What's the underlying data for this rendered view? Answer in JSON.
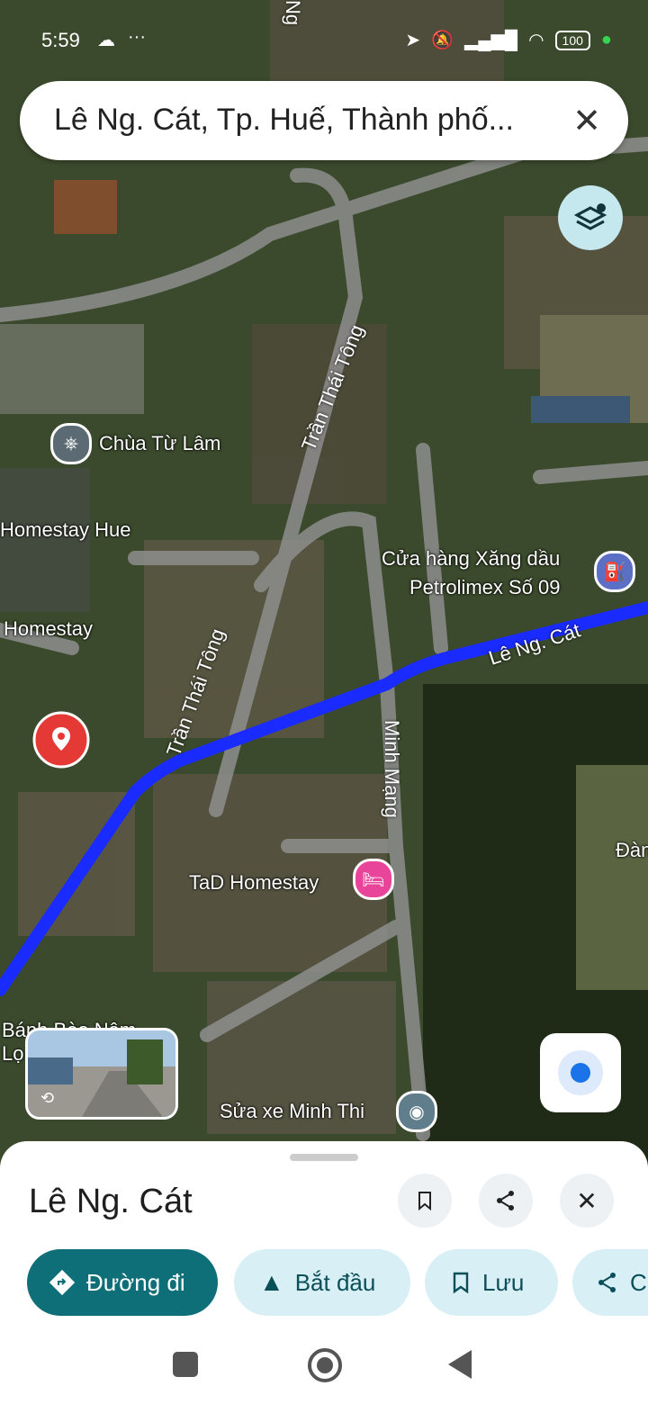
{
  "status_bar": {
    "time": "5:59",
    "dots": "···",
    "battery": "100"
  },
  "search": {
    "query": "Lê Ng. Cát, Tp. Huế, Thành phố...",
    "close": "✕"
  },
  "map": {
    "pois": [
      {
        "label": "Chùa Từ Lâm",
        "icon": "temple-icon"
      },
      {
        "label": "Homestay Hue",
        "icon": "none"
      },
      {
        "label": "Homestay",
        "icon": "none"
      },
      {
        "label": "Cửa hàng Xăng dầu",
        "label2": "Petrolimex Số 09",
        "icon": "gas-station-icon"
      },
      {
        "label": "TaD Homestay",
        "icon": "bed-icon"
      },
      {
        "label": "Bánh Bèo Nậm",
        "label2": "Lọ",
        "icon": "none"
      },
      {
        "label": "Sửa xe Minh Thi",
        "icon": "pin-icon"
      },
      {
        "label": "Đàn",
        "icon": "none"
      }
    ],
    "streets": [
      "Trần Thái Tông",
      "Trần Thái Tông",
      "Lê Ng. Cát",
      "Minh Mạng",
      "Ng"
    ],
    "route_color": "#1a2bff"
  },
  "sheet": {
    "title": "Lê Ng. Cát",
    "buttons": {
      "directions": "Đường đi",
      "start": "Bắt đầu",
      "save": "Lưu",
      "share": "C"
    }
  },
  "colors": {
    "accent": "#0f6f78",
    "chip_bg": "#d7eff5",
    "pin_red": "#e53935"
  }
}
